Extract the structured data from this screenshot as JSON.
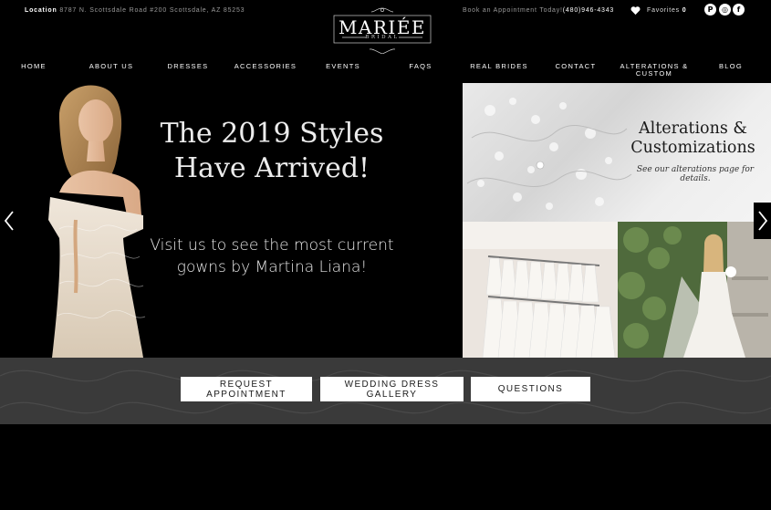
{
  "topbar": {
    "location_label": "Location",
    "address": "8787 N. Scottsdale Road #200 Scottsdale, AZ 85253",
    "book_text": "Book an Appointment Today!",
    "phone": "(480)946-4343",
    "favorites_label": "Favorites",
    "favorites_count": "0"
  },
  "logo": {
    "name": "MARIÉE",
    "sub": "BRIDAL"
  },
  "social": [
    {
      "icon": "pinterest-icon",
      "glyph": "P"
    },
    {
      "icon": "instagram-icon",
      "glyph": "◎"
    },
    {
      "icon": "facebook-icon",
      "glyph": "f"
    }
  ],
  "nav": [
    "HOME",
    "ABOUT US",
    "DRESSES",
    "ACCESSORIES",
    "EVENTS",
    "FAQS",
    "REAL BRIDES",
    "CONTACT",
    "ALTERATIONS & CUSTOM",
    "BLOG"
  ],
  "hero": {
    "title_line1": "The 2019 Styles",
    "title_line2": "Have Arrived!",
    "sub_line1": "Visit us to see the most current",
    "sub_line2": "gowns by Martina Liana!"
  },
  "alterations": {
    "title_line1": "Alterations &",
    "title_line2": "Customizations",
    "note": "See our alterations page for details."
  },
  "cta": {
    "request": "REQUEST APPOINTMENT",
    "gallery": "WEDDING DRESS GALLERY",
    "questions": "QUESTIONS"
  },
  "colors": {
    "background": "#000000",
    "band": "#3a3a3a",
    "button": "#ffffff",
    "muted_text": "#9a9a9a"
  }
}
